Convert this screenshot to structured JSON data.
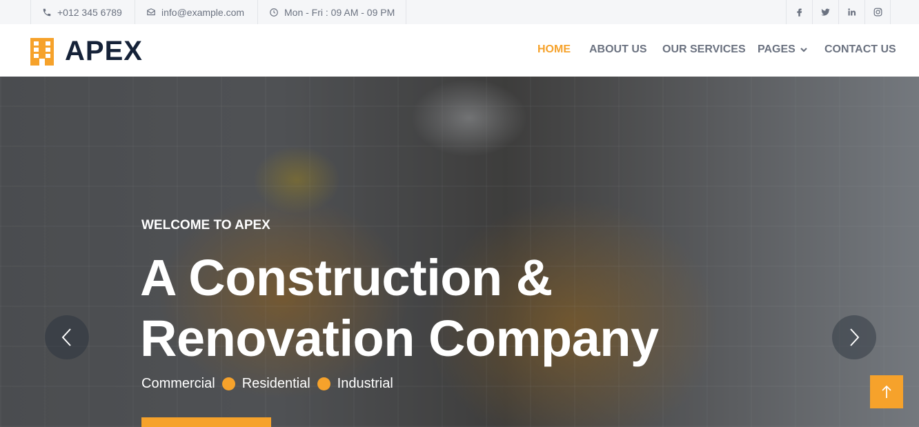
{
  "topbar": {
    "phone": "+012 345 6789",
    "email": "info@example.com",
    "hours": "Mon - Fri : 09 AM - 09 PM",
    "social_icons": [
      "facebook-icon",
      "twitter-icon",
      "linkedin-icon",
      "instagram-icon"
    ]
  },
  "brand": {
    "name": "APEX",
    "icon": "building-icon"
  },
  "nav": {
    "home": "HOME",
    "about": "ABOUT US",
    "services": "OUR SERVICES",
    "pages": "PAGES",
    "contact": "CONTACT US"
  },
  "hero": {
    "welcome": "WELCOME TO APEX",
    "headline_line1": "A Construction &",
    "headline_line2": "Renovation Company",
    "tags": [
      "Commercial",
      "Residential",
      "Industrial"
    ]
  },
  "colors": {
    "accent": "#f6a22b",
    "dark": "#152238",
    "muted": "#6b7280"
  }
}
